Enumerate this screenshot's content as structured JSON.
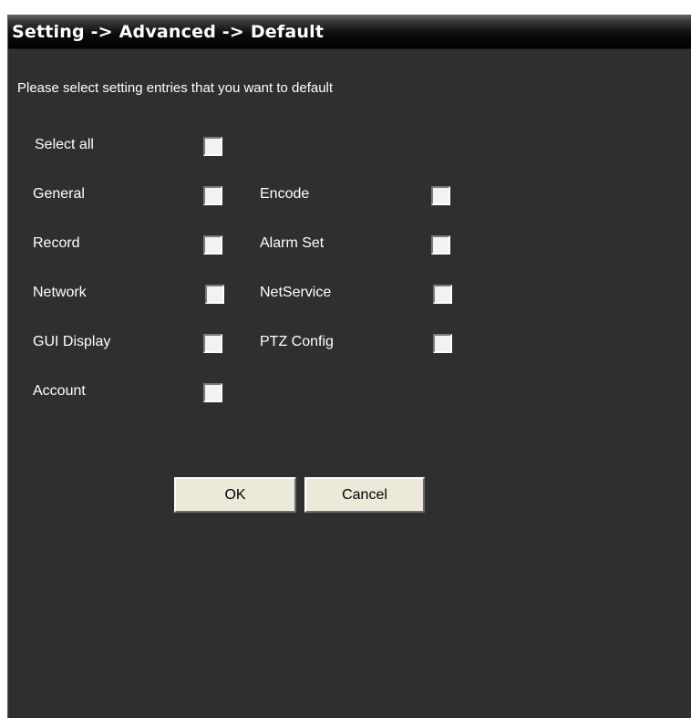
{
  "window": {
    "title": "Setting -> Advanced -> Default"
  },
  "instruction": "Please select setting entries that you want to default",
  "options": {
    "select_all": "Select all",
    "general": "General",
    "encode": "Encode",
    "record": "Record",
    "alarm_set": "Alarm Set",
    "network": "Network",
    "net_service": "NetService",
    "gui_display": "GUI Display",
    "ptz_config": "PTZ Config",
    "account": "Account"
  },
  "checked": {
    "select_all": false,
    "general": false,
    "encode": false,
    "record": false,
    "alarm_set": false,
    "network": false,
    "net_service": false,
    "gui_display": false,
    "ptz_config": false,
    "account": false
  },
  "buttons": {
    "ok": "OK",
    "cancel": "Cancel"
  },
  "colors": {
    "panel_background": "#2f2f2f",
    "title_text": "#ffffff",
    "label_text": "#ffffff",
    "button_face": "#ece9d8"
  }
}
